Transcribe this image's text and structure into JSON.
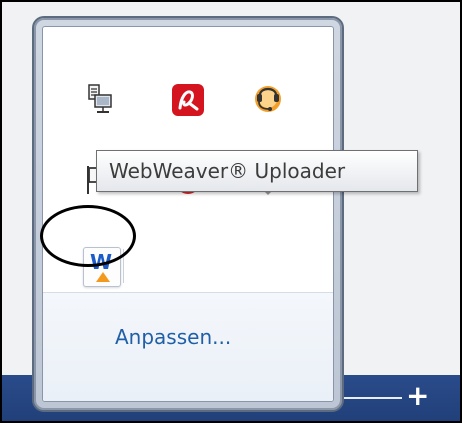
{
  "tooltip": {
    "text": "WebWeaver® Uploader"
  },
  "flyout": {
    "customize_label": "Anpassen..."
  },
  "icons": {
    "network": "network-icon",
    "avira": "avira-antivirus-icon",
    "headset": "headset-icon",
    "action_center": "action-center-flag-icon",
    "red_app": "red-app-icon",
    "gray_app": "gray-app-icon",
    "webweaver": "webweaver-uploader-icon",
    "webweaver_letter": "W"
  },
  "colors": {
    "taskbar": "#21407a",
    "link": "#1f5fa8",
    "avira_red": "#d4141e",
    "webweaver_blue": "#1d5cc8",
    "webweaver_orange": "#f39a1e"
  }
}
